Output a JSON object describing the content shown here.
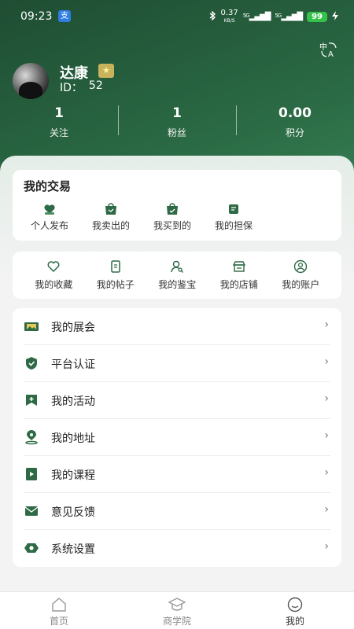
{
  "status_bar": {
    "time": "09:23",
    "app_badge": "支",
    "net_speed_value": "0.37",
    "net_speed_unit": "KB/S",
    "sig1": "5G",
    "sig2": "5G",
    "battery": "99"
  },
  "profile": {
    "name": "达康",
    "id_label": "ID：",
    "id_value": "52"
  },
  "stats": [
    {
      "value": "1",
      "label": "关注"
    },
    {
      "value": "1",
      "label": "粉丝"
    },
    {
      "value": "0.00",
      "label": "积分"
    }
  ],
  "trade": {
    "title": "我的交易",
    "items": [
      {
        "label": "个人发布",
        "icon": "publish-icon"
      },
      {
        "label": "我卖出的",
        "icon": "sold-icon"
      },
      {
        "label": "我买到的",
        "icon": "bought-icon"
      },
      {
        "label": "我的担保",
        "icon": "guarantee-icon"
      }
    ]
  },
  "quick": {
    "items": [
      {
        "label": "我的收藏",
        "icon": "heart-icon"
      },
      {
        "label": "我的帖子",
        "icon": "document-icon"
      },
      {
        "label": "我的鉴宝",
        "icon": "appraisal-icon"
      },
      {
        "label": "我的店铺",
        "icon": "shop-icon"
      },
      {
        "label": "我的账户",
        "icon": "account-icon"
      }
    ]
  },
  "menu": {
    "items": [
      {
        "label": "我的展会",
        "icon": "exhibition-icon"
      },
      {
        "label": "平台认证",
        "icon": "shield-icon"
      },
      {
        "label": "我的活动",
        "icon": "activity-icon"
      },
      {
        "label": "我的地址",
        "icon": "location-icon"
      },
      {
        "label": "我的课程",
        "icon": "course-icon"
      },
      {
        "label": "意见反馈",
        "icon": "mail-icon"
      },
      {
        "label": "系统设置",
        "icon": "settings-icon"
      }
    ],
    "chevron": "›"
  },
  "tabbar": {
    "items": [
      {
        "label": "首页",
        "icon": "home-icon"
      },
      {
        "label": "商学院",
        "icon": "academy-icon"
      },
      {
        "label": "我的",
        "icon": "profile-icon"
      }
    ],
    "active_index": 2
  },
  "colors": {
    "header_dark": "#1f4d33",
    "accent_green": "#2e6a45",
    "battery": "#35c24a"
  }
}
